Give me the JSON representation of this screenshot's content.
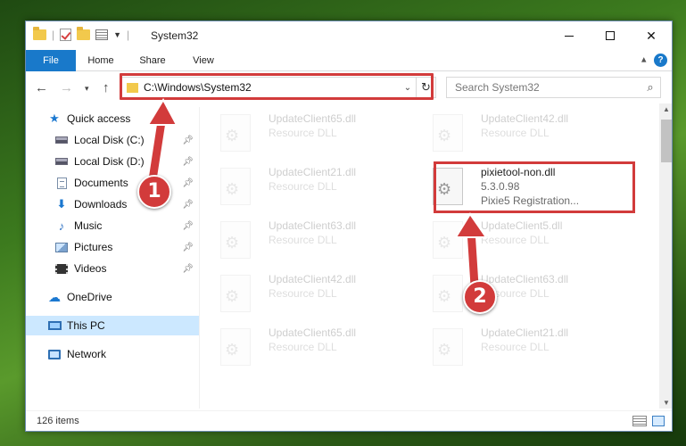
{
  "window": {
    "title": "System32",
    "caption": {
      "close_label": "✕"
    }
  },
  "ribbon": {
    "tabs": [
      {
        "label": "File"
      },
      {
        "label": "Home"
      },
      {
        "label": "Share"
      },
      {
        "label": "View"
      }
    ],
    "help_label": "?"
  },
  "address": {
    "path": "C:\\Windows\\System32",
    "search_placeholder": "Search System32"
  },
  "sidebar": {
    "items": [
      {
        "label": "Quick access",
        "icon": "star-icon"
      },
      {
        "label": "Local Disk (C:)",
        "icon": "disk-icon",
        "pinned": true
      },
      {
        "label": "Local Disk (D:)",
        "icon": "disk-icon",
        "pinned": true
      },
      {
        "label": "Documents",
        "icon": "documents-icon",
        "pinned": true
      },
      {
        "label": "Downloads",
        "icon": "downloads-icon",
        "pinned": true
      },
      {
        "label": "Music",
        "icon": "music-icon",
        "pinned": true
      },
      {
        "label": "Pictures",
        "icon": "pictures-icon",
        "pinned": true
      },
      {
        "label": "Videos",
        "icon": "videos-icon",
        "pinned": true
      },
      {
        "label": "OneDrive",
        "icon": "onedrive-icon"
      },
      {
        "label": "This PC",
        "icon": "this-pc-icon",
        "selected": true
      },
      {
        "label": "Network",
        "icon": "network-icon"
      }
    ]
  },
  "files": [
    {
      "name": "UpdateClient65.dll",
      "desc": "Resource DLL"
    },
    {
      "name": "UpdateClient42.dll",
      "desc": "Resource DLL"
    },
    {
      "name": "UpdateClient21.dll",
      "desc": "Resource DLL"
    },
    {
      "name": "pixietool-non.dll",
      "version": "5.3.0.98",
      "desc": "Pixie5 Registration..."
    },
    {
      "name": "UpdateClient63.dll",
      "desc": "Resource DLL"
    },
    {
      "name": "UpdateClient5.dll",
      "desc": "Resource DLL"
    },
    {
      "name": "UpdateClient42.dll",
      "desc": "Resource DLL"
    },
    {
      "name": "UpdateClient63.dll",
      "desc": "Resource DLL"
    },
    {
      "name": "UpdateClient65.dll",
      "desc": "Resource DLL"
    },
    {
      "name": "UpdateClient21.dll",
      "desc": "Resource DLL"
    }
  ],
  "status": {
    "item_count": "126 items"
  },
  "annotations": {
    "step1": "1",
    "step2": "2",
    "highlight_color": "#d23b3b"
  },
  "colors": {
    "accent": "#1979ca",
    "selected_bg": "#cce8ff"
  }
}
